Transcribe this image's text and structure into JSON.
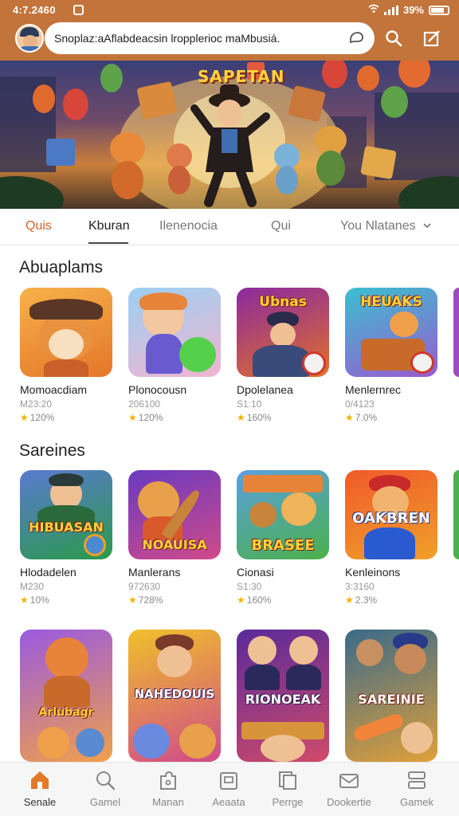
{
  "status_bar": {
    "time": "4:7.2460",
    "battery": "39%"
  },
  "header": {
    "search_text": "Snoplaz:aAflabdeacsin lropplerioc maMbusiá.",
    "icons": [
      "avatar",
      "voice-icon",
      "search-icon",
      "edit-icon"
    ],
    "accent_color": "#c2743a"
  },
  "banner": {
    "title": "SAPETAN"
  },
  "tabs": [
    {
      "label": "Quis"
    },
    {
      "label": "Kburan"
    },
    {
      "label": "Ilenenocia"
    },
    {
      "label": "Qui"
    },
    {
      "label": "You Nlatanes"
    }
  ],
  "sections": [
    {
      "title": "Abuaplams",
      "items": [
        {
          "name": "Momoacdiam",
          "size": "M23:20",
          "rating": "120%"
        },
        {
          "name": "Plonocousn",
          "size": "206100",
          "rating": "120%"
        },
        {
          "name": "Dpolelanea",
          "size": "S1:10",
          "rating": "160%"
        },
        {
          "name": "Menlernrec",
          "size": "0/4123",
          "rating": "7.0%"
        }
      ]
    },
    {
      "title": "Sareines",
      "items": [
        {
          "name": "Hlodadelen",
          "size": "M230",
          "rating": "10%",
          "logo": "HIBUASAN"
        },
        {
          "name": "Manlerans",
          "size": "972630",
          "rating": "728%",
          "logo": "NOAUISA"
        },
        {
          "name": "Cionasi",
          "size": "S1:30",
          "rating": "160%",
          "logo": "BRASEE"
        },
        {
          "name": "Kenleinons",
          "size": "3:3160",
          "rating": "2.3%",
          "logo": "OAKBREN"
        }
      ]
    },
    {
      "title": "",
      "items": [
        {
          "logo": "Arlubagr"
        },
        {
          "logo": "NAHEDOUIS"
        },
        {
          "logo": "RIONOEAK"
        },
        {
          "logo": "SAREINIE"
        }
      ]
    }
  ],
  "bottom_nav": [
    {
      "label": "Senale",
      "icon": "home-icon"
    },
    {
      "label": "Gamel",
      "icon": "search-icon"
    },
    {
      "label": "Manan",
      "icon": "puzzle-icon"
    },
    {
      "label": "Aeaata",
      "icon": "box-icon"
    },
    {
      "label": "Perrge",
      "icon": "copy-icon"
    },
    {
      "label": "Dookertie",
      "icon": "mail-icon"
    },
    {
      "label": "Gamek",
      "icon": "menu-icon"
    }
  ]
}
